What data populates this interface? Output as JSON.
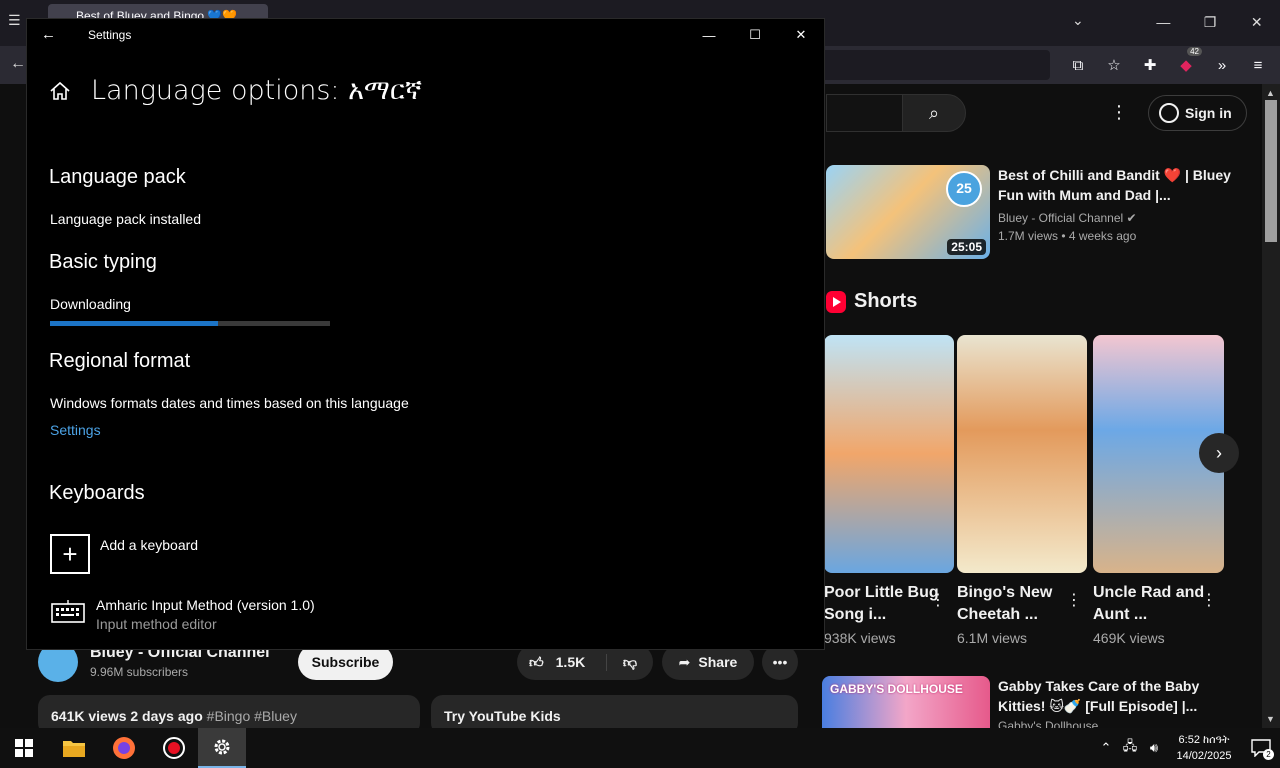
{
  "browser": {
    "tab_title": "Best of Bluey and Bingo 💙🧡",
    "extension_badge": "42"
  },
  "youtube": {
    "sign_in": "Sign in",
    "video1": {
      "title": "Best of Chilli and Bandit ❤️ | Bluey Fun with Mum and Dad |...",
      "channel": "Bluey - Official Channel",
      "stats": "1.7M views • 4 weeks ago",
      "duration": "25:05",
      "badge": "25"
    },
    "shorts_label": "Shorts",
    "shorts": [
      {
        "title": "Poor Little Bug Song i...",
        "views": "938K views"
      },
      {
        "title": "Bingo's New Cheetah ...",
        "views": "6.1M views"
      },
      {
        "title": "Uncle Rad and Aunt ...",
        "views": "469K views"
      }
    ],
    "channel_name": "Bluey - Official Channel",
    "subscribers": "9.96M subscribers",
    "subscribe": "Subscribe",
    "likes": "1.5K",
    "share": "Share",
    "desc_stats": "641K views  2 days ago",
    "desc_tags": "#Bingo #Bluey",
    "try_kids": "Try YouTube Kids",
    "video2": {
      "title": "Gabby Takes Care of the Baby Kitties! 🐱🍼 [Full Episode] |...",
      "channel": "Gabby's Dollhouse",
      "thumb_text": "GABBY'S DOLLHOUSE"
    }
  },
  "settings": {
    "window_title": "Settings",
    "heading": "Language options: አማርኛ",
    "language_pack": {
      "heading": "Language pack",
      "status": "Language pack installed"
    },
    "basic_typing": {
      "heading": "Basic typing",
      "status": "Downloading",
      "progress": 0.6
    },
    "regional_format": {
      "heading": "Regional format",
      "description": "Windows formats dates and times based on this language",
      "link": "Settings"
    },
    "keyboards": {
      "heading": "Keyboards",
      "add_label": "Add a keyboard",
      "items": [
        {
          "name": "Amharic Input Method (version 1.0)",
          "type": "Input method editor"
        }
      ]
    }
  },
  "taskbar": {
    "time": "6:52 ከሰዓት",
    "date": "14/02/2025",
    "notifications": "2"
  }
}
